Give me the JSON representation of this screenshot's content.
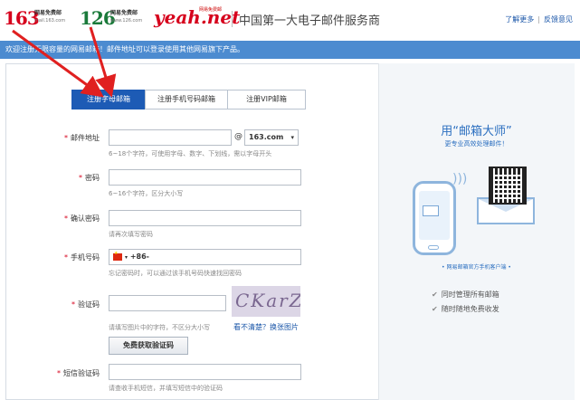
{
  "header": {
    "logo_163": {
      "num": "163",
      "name": "网易免费邮",
      "domain": "mail.163.com"
    },
    "logo_126": {
      "num": "126",
      "name": "网易免费邮",
      "domain": "www.126.com"
    },
    "logo_yeah": {
      "text": "yeah.net",
      "tag": "网易免费邮"
    },
    "slogan": "中国第一大电子邮件服务商",
    "link_more": "了解更多",
    "link_feedback": "反馈意见"
  },
  "notice": "欢迎注册无限容量的网易邮箱！邮件地址可以登录使用其他网易旗下产品。",
  "tabs": [
    {
      "label": "注册字母邮箱",
      "active": true
    },
    {
      "label": "注册手机号码邮箱",
      "active": false
    },
    {
      "label": "注册VIP邮箱",
      "active": false
    }
  ],
  "form": {
    "email": {
      "label": "邮件地址",
      "at": "@",
      "domain": "163.com",
      "hint": "6~18个字符，可使用字母、数字、下划线，需以字母开头"
    },
    "password": {
      "label": "密码",
      "hint": "6~16个字符，区分大小写"
    },
    "confirm": {
      "label": "确认密码",
      "hint": "请再次填写密码"
    },
    "phone": {
      "label": "手机号码",
      "prefix": "+86-",
      "hint": "忘记密码时，可以通过该手机号码快速找回密码"
    },
    "captcha": {
      "label": "验证码",
      "image_text": "CKarZB",
      "hint": "请填写图片中的字符，不区分大小写",
      "refresh": "看不清楚？换张图片"
    },
    "sms_button": "免费获取验证码",
    "sms": {
      "label": "短信验证码",
      "hint": "请查收手机短信，并填写短信中的验证码"
    }
  },
  "promo": {
    "title": "用“邮箱大师”",
    "subtitle": "更专业高效处理邮件！",
    "footer": "• 网易邮箱官方手机客户端 •",
    "features": [
      "同时管理所有邮箱",
      "随时随地免费收发"
    ]
  },
  "colors": {
    "accent": "#1d5bb5",
    "notice_bg": "#4c8bd0",
    "brand_red": "#d6001c",
    "annotation_arrow": "#e02020"
  }
}
